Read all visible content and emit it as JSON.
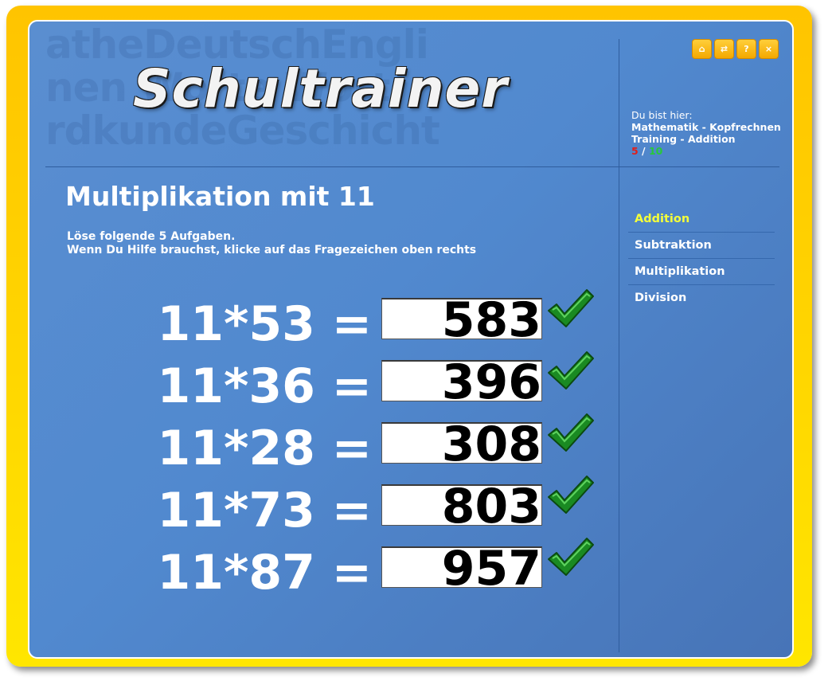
{
  "header": {
    "logo_text": "Schultrainer",
    "background_words": [
      "atheDeutschEngli",
      "nen Worte Wort",
      "rdkundeGeschicht"
    ]
  },
  "toolbar": {
    "icons": [
      "home-icon",
      "swap-icon",
      "help-icon",
      "close-icon"
    ],
    "home_glyph": "⌂",
    "swap_glyph": "⇄",
    "help_glyph": "?",
    "close_glyph": "×"
  },
  "location": {
    "label": "Du bist hier:",
    "path_line1": "Mathematik - Kopfrechnen",
    "path_line2": "Training - Addition",
    "score_current": "5",
    "score_separator": " / ",
    "score_total": "10"
  },
  "main": {
    "title": "Multiplikation mit 11",
    "instruction_line1": "Löse folgende 5 Aufgaben.",
    "instruction_line2": "Wenn Du Hilfe brauchst, klicke auf das Fragezeichen oben rechts",
    "tasks": [
      {
        "expression": "11*53 =",
        "answer": "583",
        "status": "correct"
      },
      {
        "expression": "11*36 =",
        "answer": "396",
        "status": "correct"
      },
      {
        "expression": "11*28 =",
        "answer": "308",
        "status": "correct"
      },
      {
        "expression": "11*73 =",
        "answer": "803",
        "status": "correct"
      },
      {
        "expression": "11*87 =",
        "answer": "957",
        "status": "correct"
      }
    ]
  },
  "sidebar": {
    "items": [
      {
        "label": "Addition",
        "active": true
      },
      {
        "label": "Subtraktion",
        "active": false
      },
      {
        "label": "Multiplikation",
        "active": false
      },
      {
        "label": "Division",
        "active": false
      }
    ]
  },
  "colors": {
    "frame": "#ffd200",
    "panel": "#5189cf",
    "active_nav": "#f4ff3a",
    "check_green": "#1a8a22",
    "score_red": "#e0201a",
    "score_green": "#28c83a"
  }
}
